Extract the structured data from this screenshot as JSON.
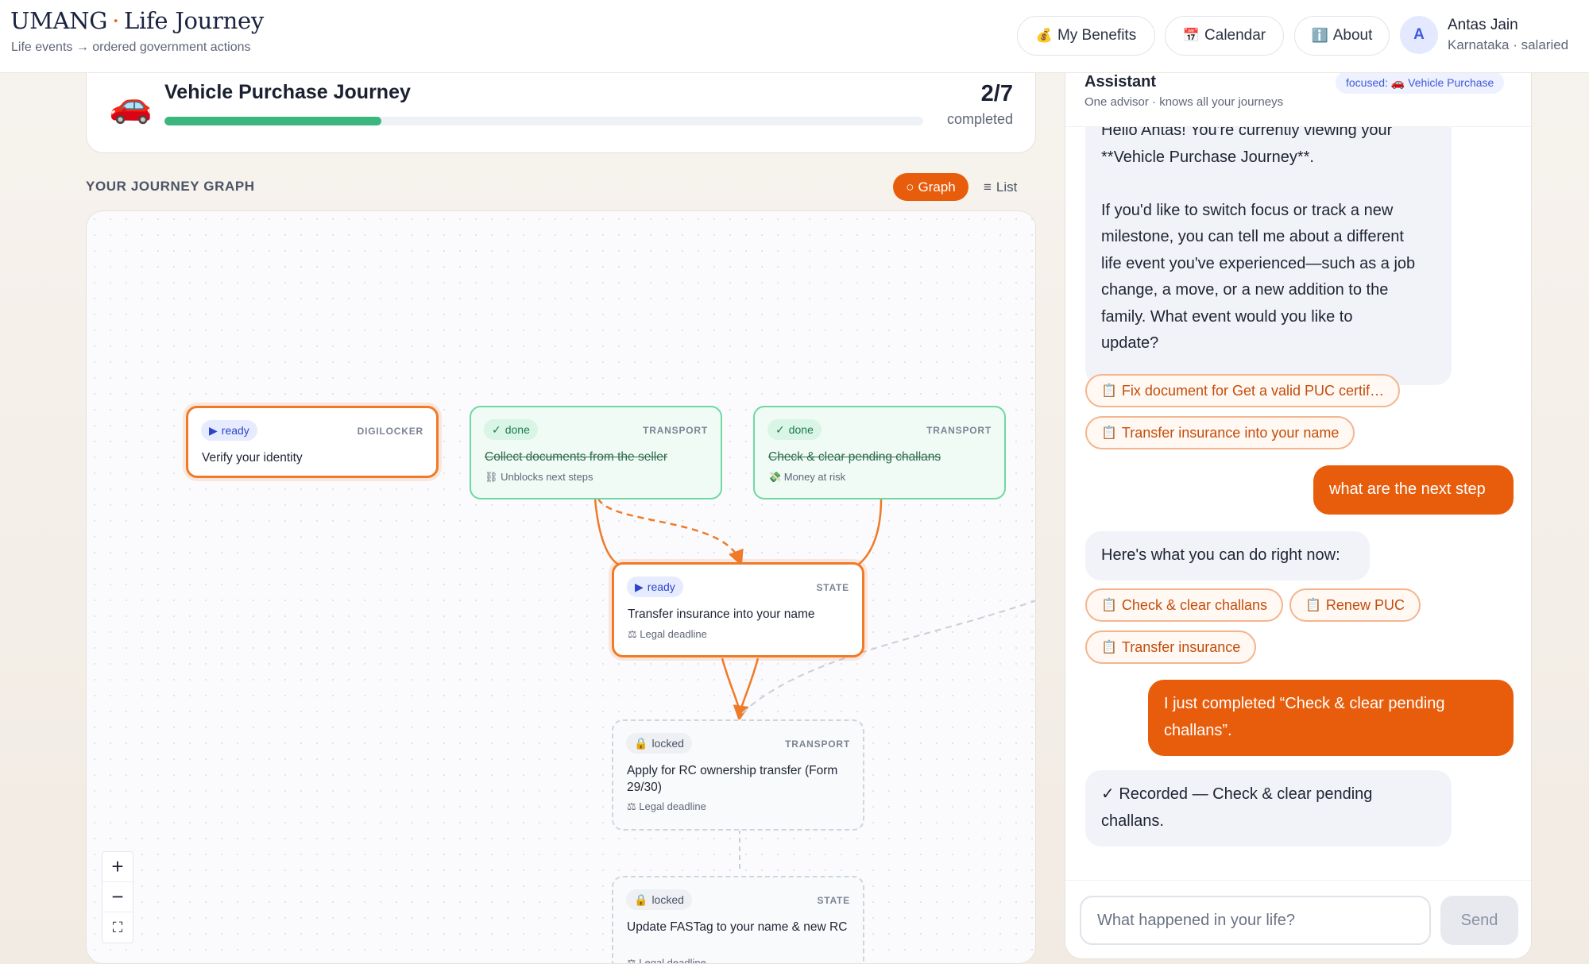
{
  "header": {
    "brand": "UMANG",
    "brand_sep": "·",
    "product": "Life Journey",
    "subtitle": "Life events → ordered government actions",
    "nav": [
      {
        "label": "My Benefits",
        "icon": "💰"
      },
      {
        "label": "Calendar",
        "icon": "📅"
      },
      {
        "label": "About",
        "icon": "ℹ️"
      }
    ],
    "user": {
      "initial": "A",
      "name": "Antas Jain",
      "meta": "Karnataka · salaried"
    }
  },
  "journey": {
    "icon": "🚗",
    "title": "Vehicle Purchase Journey",
    "progress_text": "2/7",
    "progress_label": "completed",
    "progress_fraction": 0.2857
  },
  "graph": {
    "section_title": "YOUR JOURNEY GRAPH",
    "view_graph": "Graph",
    "view_list": "List",
    "nodes": [
      {
        "status": "ready",
        "status_icon": "▶",
        "tag": "DIGILOCKER",
        "title": "Verify your identity",
        "hint": ""
      },
      {
        "status": "done",
        "status_icon": "✓",
        "tag": "TRANSPORT",
        "title": "Collect documents from the seller",
        "hint": "⛓ Unblocks next steps"
      },
      {
        "status": "done",
        "status_icon": "✓",
        "tag": "TRANSPORT",
        "title": "Check & clear pending challans",
        "hint": "💸 Money at risk"
      },
      {
        "status": "ready",
        "status_icon": "▶",
        "tag": "STATE",
        "title": "Transfer insurance into your name",
        "hint": "⚖ Legal deadline"
      },
      {
        "status": "locked",
        "status_icon": "🔒",
        "tag": "TRANSPORT",
        "title": "Apply for RC ownership transfer (Form 29/30)",
        "hint": "⚖ Legal deadline"
      },
      {
        "status": "locked",
        "status_icon": "🔒",
        "tag": "STATE",
        "title": "Update FASTag to your name & new RC",
        "hint": "⚖ Legal deadline"
      }
    ],
    "zoom": {
      "in": "+",
      "out": "−",
      "fit": "⛶"
    }
  },
  "assistant": {
    "title": "Assistant",
    "subtitle": "One advisor · knows all your journeys",
    "focus": "focused: 🚗 Vehicle Purchase",
    "messages": {
      "bot1_l1": "Hello Antas! You're currently viewing your",
      "bot1_l2": "**Vehicle Purchase Journey**.",
      "bot1_l3": "If you'd like to switch focus or track a new",
      "bot1_l4": "milestone, you can tell me about a different",
      "bot1_l5": "life event you've experienced—such as a job",
      "bot1_l6": "change, a move, or a new addition to the",
      "bot1_l7": "family. What event would you like to",
      "bot1_l8": "update?",
      "chip1": "Fix document for Get a valid PUC certif…",
      "chip2": "Transfer insurance into your name",
      "user1": "what are the next step",
      "bot2": "Here's what you can do right now:",
      "chip3": "Check & clear challans",
      "chip4": "Renew PUC",
      "chip5": "Transfer insurance",
      "user2_l1": "I just completed “Check & clear pending",
      "user2_l2": "challans”.",
      "bot3_l1": "✓ Recorded — Check & clear pending",
      "bot3_l2": "challans."
    },
    "chip_icon": "📋",
    "input_placeholder": "What happened in your life?",
    "send_label": "Send"
  }
}
